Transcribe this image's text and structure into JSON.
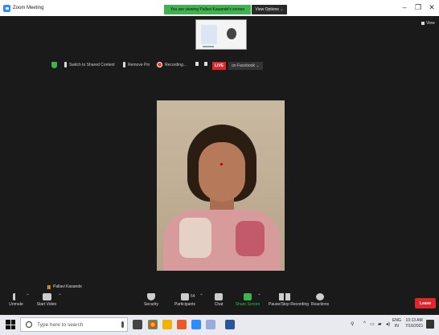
{
  "window": {
    "title": "Zoom Meeting",
    "controls": [
      "–",
      "❐",
      "✕"
    ]
  },
  "share_banner": {
    "status": "You are viewing Pallavi Kasande's screen",
    "view_options": "View Options ⌄"
  },
  "view_button": "View",
  "share_toolbar": {
    "switch": "Switch to Shared Content",
    "remove_pin": "Remove Pin",
    "recording": "Recording...",
    "live": "LIVE",
    "live_target": "on Facebook ⌄"
  },
  "speaker": {
    "name": "Pallavi Kasande"
  },
  "controls": {
    "unmute": "Unmute",
    "start_video": "Start Video",
    "security": "Security",
    "participants": "Participants",
    "participants_count": "64",
    "chat": "Chat",
    "share_screen": "Share Screen",
    "record": "Pause/Stop Recording",
    "reactions": "Reactions",
    "leave": "Leave"
  },
  "taskbar": {
    "search_placeholder": "Type here to search",
    "lang_top": "ENG",
    "lang_bottom": "IN",
    "time": "10:13 AM",
    "date": "7/16/2021"
  },
  "colors": {
    "green": "#3eb34f",
    "red": "#e0262b",
    "dark_bg": "#1a1a1a"
  }
}
